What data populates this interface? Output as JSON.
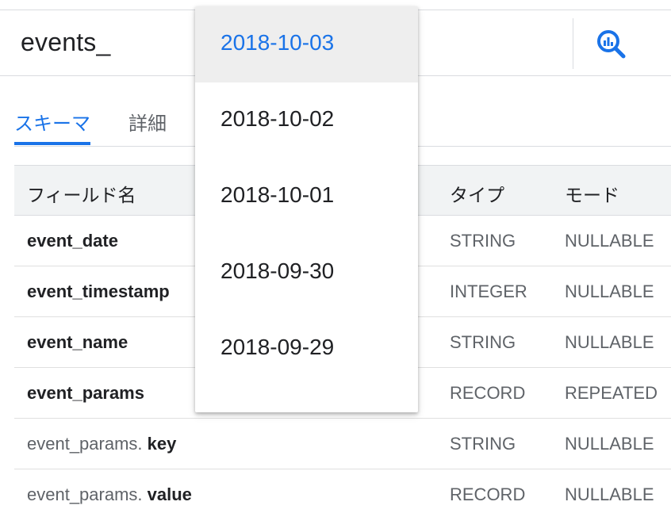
{
  "header": {
    "table_name": "events_",
    "query_icon": "query-table-icon"
  },
  "tabs": [
    {
      "label": "スキーマ",
      "active": true
    },
    {
      "label": "詳細",
      "active": false
    }
  ],
  "schema": {
    "columns": {
      "name": "フィールド名",
      "type": "タイプ",
      "mode": "モード"
    },
    "rows": [
      {
        "prefix": "",
        "name": "event_date",
        "type": "STRING",
        "mode": "NULLABLE"
      },
      {
        "prefix": "",
        "name": "event_timestamp",
        "type": "INTEGER",
        "mode": "NULLABLE"
      },
      {
        "prefix": "",
        "name": "event_name",
        "type": "STRING",
        "mode": "NULLABLE"
      },
      {
        "prefix": "",
        "name": "event_params",
        "type": "RECORD",
        "mode": "REPEATED"
      },
      {
        "prefix": "event_params. ",
        "name": "key",
        "type": "STRING",
        "mode": "NULLABLE"
      },
      {
        "prefix": "event_params. ",
        "name": "value",
        "type": "RECORD",
        "mode": "NULLABLE"
      }
    ]
  },
  "date_dropdown": {
    "selected": "2018-10-03",
    "options": [
      "2018-10-03",
      "2018-10-02",
      "2018-10-01",
      "2018-09-30",
      "2018-09-29"
    ]
  },
  "colors": {
    "accent": "#1a73e8",
    "selected_bg": "#eeeeee",
    "header_bg": "#f1f3f4"
  }
}
